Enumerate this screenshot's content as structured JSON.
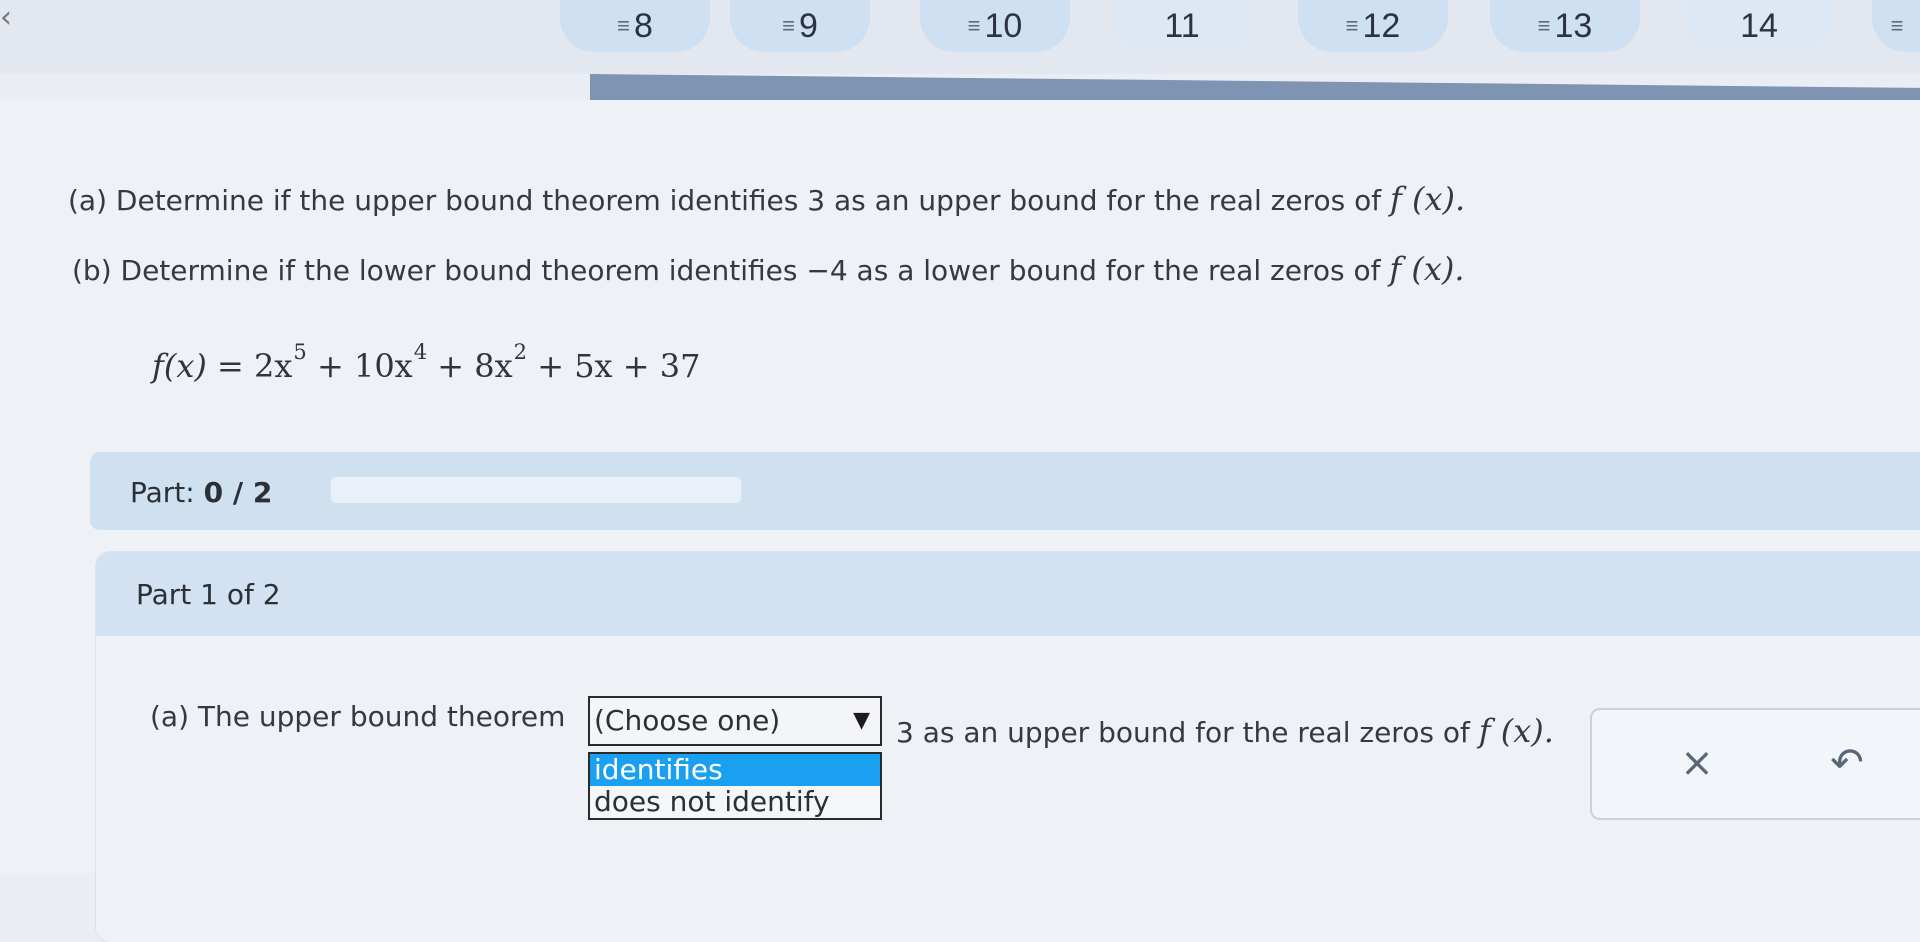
{
  "nav": {
    "items": [
      {
        "label": "8",
        "lines": true
      },
      {
        "label": "9",
        "lines": true
      },
      {
        "label": "10",
        "lines": true
      },
      {
        "label": "11",
        "lines": false
      },
      {
        "label": "12",
        "lines": true
      },
      {
        "label": "13",
        "lines": true
      },
      {
        "label": "14",
        "lines": false
      }
    ],
    "lines_glyph": "≡"
  },
  "question": {
    "part_a_text": "(a) Determine if the upper bound theorem identifies 3 as an upper bound for the real zeros of",
    "part_b_text": "(b) Determine if the lower bound theorem identifies −4 as a lower bound for the real zeros of",
    "fx_label": "f (x).",
    "formula": {
      "lhs": "f(x) = ",
      "t1_coef": "2x",
      "t1_exp": "5",
      "t2_coef": " + 10x",
      "t2_exp": "4",
      "t3_coef": " + 8x",
      "t3_exp": "2",
      "rest": " + 5x + 37"
    }
  },
  "part_progress": {
    "label": "Part:",
    "value": "0 / 2"
  },
  "step": {
    "header": "Part 1 of 2",
    "prompt_before": "(a) The upper bound theorem",
    "select": {
      "placeholder": "(Choose one)",
      "options": [
        "identifies",
        "does not identify"
      ],
      "highlighted_option": "identifies"
    },
    "prompt_after": "3 as an upper bound for the real zeros of",
    "fx_label": "f (x)."
  },
  "actions": {
    "clear_glyph": "×",
    "undo_glyph": "↶"
  },
  "colors": {
    "highlight": "#1aa0f0",
    "banner": "#cfe0f1",
    "progress_band": "#7f93b3"
  }
}
